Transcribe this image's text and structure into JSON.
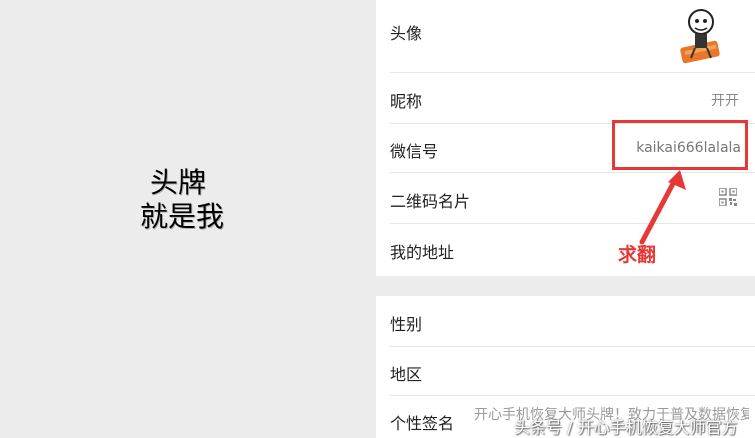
{
  "left_panel": {
    "caption_line1": "头牌",
    "caption_line2": "就是我"
  },
  "profile": {
    "rows": [
      {
        "label": "头像",
        "value": ""
      },
      {
        "label": "昵称",
        "value": "开开"
      },
      {
        "label": "微信号",
        "value": "kaikai666lalala"
      },
      {
        "label": "二维码名片",
        "value": ""
      },
      {
        "label": "我的地址",
        "value": ""
      },
      {
        "label": "性别",
        "value": ""
      },
      {
        "label": "地区",
        "value": ""
      },
      {
        "label": "个性签名",
        "value": "开心手机恢复大师头牌！致力于普及数据恢复知识！"
      }
    ]
  },
  "annotation": {
    "text": "求翻",
    "color": "#e53935"
  },
  "watermark": {
    "text": "头条号 / 开心手机恢复大师官方"
  },
  "colors": {
    "panel_bg": "#ececec",
    "accent_red": "#e53935"
  }
}
